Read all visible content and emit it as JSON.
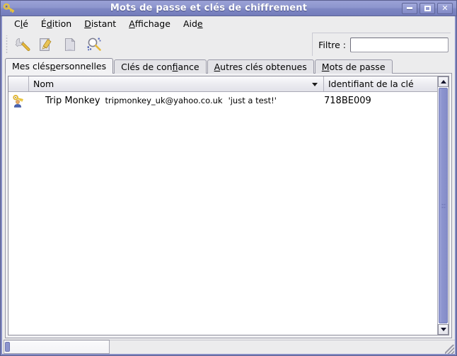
{
  "window": {
    "title": "Mots de passe et clés de chiffrement",
    "icon": "key-icon",
    "controls": {
      "minimize": "minimize-icon",
      "maximize": "maximize-icon",
      "close": "close-icon"
    }
  },
  "menubar": {
    "items": [
      {
        "label": "Clé",
        "pre": "C",
        "mnemonic": "l",
        "post": "é"
      },
      {
        "label": "Édition",
        "pre": "É",
        "mnemonic": "d",
        "post": "ition"
      },
      {
        "label": "Distant",
        "pre": "",
        "mnemonic": "D",
        "post": "istant"
      },
      {
        "label": "Affichage",
        "pre": "",
        "mnemonic": "A",
        "post": "ffichage"
      },
      {
        "label": "Aide",
        "pre": "Aid",
        "mnemonic": "e",
        "post": ""
      }
    ]
  },
  "toolbar": {
    "buttons": [
      {
        "name": "new-key-button",
        "icon": "wrench-icon"
      },
      {
        "name": "import-button",
        "icon": "notepad-icon"
      },
      {
        "name": "export-button",
        "icon": "page-icon"
      },
      {
        "name": "find-remote-button",
        "icon": "magnifier-icon"
      }
    ],
    "filter": {
      "label": "Filtre :",
      "value": "",
      "placeholder": ""
    }
  },
  "tabs": [
    {
      "label": "Mes clés personnelles",
      "pre": "Mes clés ",
      "mnemonic": "p",
      "post": "ersonnelles",
      "active": true
    },
    {
      "label": "Clés de confiance",
      "pre": "Clés de con",
      "mnemonic": "fi",
      "post": "ance",
      "active": false
    },
    {
      "label": "Autres clés obtenues",
      "pre": "",
      "mnemonic": "A",
      "post": "utres clés obtenues",
      "active": false
    },
    {
      "label": "Mots de passe",
      "pre": "",
      "mnemonic": "M",
      "post": "ots de passe",
      "active": false
    }
  ],
  "keylist": {
    "columns": [
      {
        "name": "icon-column",
        "label": ""
      },
      {
        "name": "name-column",
        "label": "Nom",
        "sort": "descending"
      },
      {
        "name": "keyid-column",
        "label": "Identifiant de la clé"
      }
    ],
    "rows": [
      {
        "icon": "personal-key-icon",
        "name": "Trip Monkey",
        "email": "tripmonkey_uk@yahoo.co.uk",
        "comment": "'just a test!'",
        "keyid": "718BE009"
      }
    ]
  },
  "scrollbar": {
    "up": "scroll-up-icon",
    "down": "scroll-down-icon"
  },
  "statusbar": {
    "text": ""
  },
  "colors": {
    "titlebar_start": "#9aa1d6",
    "titlebar_end": "#737cbb",
    "window_frame": "#848cc4",
    "toolbar_bg": "#ececed",
    "panel_bg": "#f2f2f4",
    "list_bg": "#ffffff",
    "scroll_thumb": "#8b93ce"
  }
}
